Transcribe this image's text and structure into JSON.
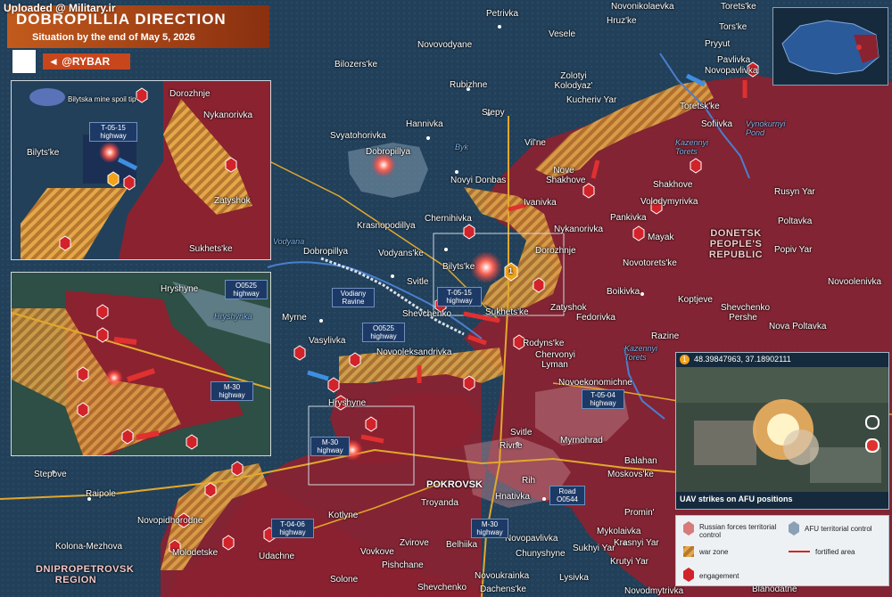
{
  "header": {
    "upload_note": "Uploaded @ Military.ir",
    "title": "DOBROPILLIA DIRECTION",
    "subtitle": "Situation by the end of May 5, 2026",
    "channel": "@RYBAR"
  },
  "colors": {
    "russian_control": "#8b2230",
    "afu_control": "#24445a",
    "war_zone": "#d9a441",
    "engagement": "#d2232a",
    "fortified": "#b8c4cc",
    "water": "#4a7fd0",
    "road": "#e2a82c"
  },
  "places": [
    {
      "name": "Petrivka"
    },
    {
      "name": "Novonikolaevka"
    },
    {
      "name": "Torets'ke"
    },
    {
      "name": "Hruz'ke"
    },
    {
      "name": "Vesele"
    },
    {
      "name": "Novovodyane"
    },
    {
      "name": "Tors'ke"
    },
    {
      "name": "Pryyut"
    },
    {
      "name": "Pavlivka"
    },
    {
      "name": "Novopavlivka"
    },
    {
      "name": "Bilozers'ke"
    },
    {
      "name": "Zolotyi Kolodyaz'"
    },
    {
      "name": "Rubizhne"
    },
    {
      "name": "Kucheriv Yar"
    },
    {
      "name": "Toretsk'ke"
    },
    {
      "name": "Stepy"
    },
    {
      "name": "Hannivka"
    },
    {
      "name": "Sofiivka"
    },
    {
      "name": "Svyatohorivka"
    },
    {
      "name": "Vil'ne"
    },
    {
      "name": "Dobropillya"
    },
    {
      "name": "Nove Shakhove"
    },
    {
      "name": "Shakhove"
    },
    {
      "name": "Rusyn Yar"
    },
    {
      "name": "Novyi Donbas"
    },
    {
      "name": "Ivanivka"
    },
    {
      "name": "Volodymyrivka"
    },
    {
      "name": "Pankivka"
    },
    {
      "name": "Poltavka"
    },
    {
      "name": "Krasnopodillya"
    },
    {
      "name": "Chernihivka"
    },
    {
      "name": "Nykanorivka"
    },
    {
      "name": "Mayak"
    },
    {
      "name": "Popiv Yar"
    },
    {
      "name": "Vodyans'ke"
    },
    {
      "name": "Dobropillya"
    },
    {
      "name": "Bilyts'ke"
    },
    {
      "name": "Dorozhnje"
    },
    {
      "name": "Novotorets'ke"
    },
    {
      "name": "Svitle"
    },
    {
      "name": "Novoolenivka"
    },
    {
      "name": "Boikivka"
    },
    {
      "name": "Zatyshok"
    },
    {
      "name": "Sukhets'ke"
    },
    {
      "name": "Koptjeve"
    },
    {
      "name": "Myrne"
    },
    {
      "name": "Shevchenko"
    },
    {
      "name": "Fedorivka"
    },
    {
      "name": "Shevchenko Pershe"
    },
    {
      "name": "Nova Poltavka"
    },
    {
      "name": "Vasylivka"
    },
    {
      "name": "Razine"
    },
    {
      "name": "Rodyns'ke"
    },
    {
      "name": "Novooleksandrivka"
    },
    {
      "name": "Chervonyi Lyman"
    },
    {
      "name": "Novoekonomichne"
    },
    {
      "name": "Hryshyne"
    },
    {
      "name": "Svitle"
    },
    {
      "name": "Myrnohrad"
    },
    {
      "name": "Rivne"
    },
    {
      "name": "Balahan"
    },
    {
      "name": "Moskovs'ke"
    },
    {
      "name": "Rih"
    },
    {
      "name": "Stepove"
    },
    {
      "name": "POKROVSK"
    },
    {
      "name": "Hnativka"
    },
    {
      "name": "Raipole"
    },
    {
      "name": "Troyanda"
    },
    {
      "name": "Promin'"
    },
    {
      "name": "Novopidhorodne"
    },
    {
      "name": "Kotlyne"
    },
    {
      "name": "Mykolaivka"
    },
    {
      "name": "Krasnyi Yar"
    },
    {
      "name": "Zvirove"
    },
    {
      "name": "Belhiika"
    },
    {
      "name": "Novopavlivka"
    },
    {
      "name": "Sukhyi Yar"
    },
    {
      "name": "Kolona-Mezhova"
    },
    {
      "name": "Molodetske"
    },
    {
      "name": "Udachne"
    },
    {
      "name": "Vovkove"
    },
    {
      "name": "Chunyshyne"
    },
    {
      "name": "Krutyi Yar"
    },
    {
      "name": "Pishchane"
    },
    {
      "name": "Solone"
    },
    {
      "name": "Novoukrainka"
    },
    {
      "name": "Lysivka"
    },
    {
      "name": "Shevchenko"
    },
    {
      "name": "Dachens'ke"
    },
    {
      "name": "Blahodatne"
    },
    {
      "name": "Novodmytrivka"
    }
  ],
  "regions": {
    "dnr": "DONETSK PEOPLE'S REPUBLIC",
    "dnipro": "DNIPROPETROVSK REGION"
  },
  "water": {
    "byk": "Byk",
    "vodyana": "Vodyana",
    "kazennyi": "Kazennyi Torets",
    "kazennyi2": "Kazennyi Torets",
    "vynokurnyi": "Vynokurnyi Pond",
    "hryshynka": "Hryshynka"
  },
  "callouts": {
    "vodiany_ravine": "Vodiany Ravine",
    "bilytska_mine": "Bilytska mine spoil tip"
  },
  "highways": {
    "t0515": "T-05-15 highway",
    "o0525": "O0525 highway",
    "m30": "M-30 highway",
    "t0504": "T-05-04 highway",
    "road_o0544": "Road O0544",
    "t0406": "T-04-06 highway"
  },
  "inset1": {
    "mine": "Bilytska mine spoil tip",
    "dorozhnje": "Dorozhnje",
    "nykanorivka": "Nykanorivka",
    "t0515": "T-05-15 highway",
    "bilytske": "Bilyts'ke",
    "zatyshok": "Zatyshok",
    "sukhetske": "Sukhets'ke"
  },
  "inset2": {
    "hryshyne": "Hryshyne",
    "o0525": "O0525 highway",
    "hryshynka": "Hryshynka",
    "m30": "M-30 highway"
  },
  "photo": {
    "marker": "1",
    "coords": "48.39847963, 37.18902111",
    "caption": "UAV strikes on AFU positions"
  },
  "legend": {
    "russian": "Russian forces territorial control",
    "afu": "AFU territorial control",
    "war": "war zone",
    "fortified": "fortified area",
    "engagement": "engagement"
  },
  "marker_number": "1"
}
